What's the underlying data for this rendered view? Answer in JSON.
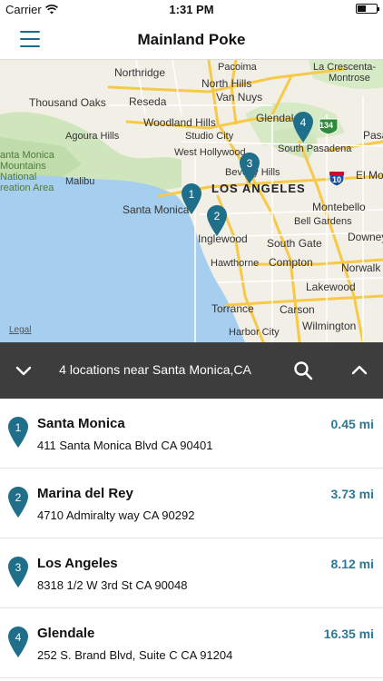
{
  "status_bar": {
    "carrier": "Carrier",
    "time": "1:31 PM"
  },
  "nav": {
    "title": "Mainland Poke"
  },
  "map": {
    "labels": {
      "pacoima": "Pacoima",
      "la_crescenta": "La Crescenta-",
      "montrose": "Montrose",
      "northridge": "Northridge",
      "north_hills": "North Hills",
      "van_nuys": "Van Nuys",
      "thousand_oaks": "Thousand Oaks",
      "reseda": "Reseda",
      "glendale": "Glendal",
      "woodland_hills": "Woodland Hills",
      "agoura_hills": "Agoura Hills",
      "studio_city": "Studio City",
      "south_pasadena": "South Pasadena",
      "pasa": "Pasa",
      "west_hollywood": "West Hollywood",
      "santa_monica_mountains": "anta Monica Mountains National reation Area",
      "malibu": "Malibu",
      "beverly_hills": "Beverly Hills",
      "el_mo": "El Mo",
      "los_angeles": "LOS ANGELES",
      "santa_monica": "Santa Monica",
      "montebello": "Montebello",
      "bell_gardens": "Bell Gardens",
      "inglewood": "Inglewood",
      "south_gate": "South Gate",
      "downey": "Downey",
      "hawthorne": "Hawthorne",
      "compton": "Compton",
      "norwalk": "Norwalk",
      "torrance": "Torrance",
      "lakewood": "Lakewood",
      "carson": "Carson",
      "wilmington": "Wilmington",
      "harbor_city": "Harbor City",
      "shield_134": "134",
      "shield_10": "10"
    },
    "legal": "Legal",
    "pins": [
      "1",
      "2",
      "3",
      "4"
    ]
  },
  "search_bar": {
    "text": "4 locations near Santa Monica,CA"
  },
  "locations": [
    {
      "num": "1",
      "name": "Santa Monica",
      "address": "411 Santa Monica Blvd CA 90401",
      "distance": "0.45 mi"
    },
    {
      "num": "2",
      "name": "Marina del Rey",
      "address": "4710 Admiralty way CA 90292",
      "distance": "3.73 mi"
    },
    {
      "num": "3",
      "name": "Los Angeles",
      "address": "8318 1/2 W 3rd St CA 90048",
      "distance": "8.12 mi"
    },
    {
      "num": "4",
      "name": "Glendale",
      "address": "252 S. Brand Blvd, Suite C CA 91204",
      "distance": "16.35 mi"
    }
  ],
  "colors": {
    "accent": "#2b7a99",
    "pin": "#1f6f8b",
    "search_bar": "#3d3d3d",
    "water": "#a6cfef",
    "park": "#cfe6bd"
  },
  "icons": {
    "menu": "hamburger-icon",
    "search": "search-icon",
    "collapse": "chevron-down-icon",
    "expand": "chevron-up-icon",
    "pin": "map-pin-icon"
  }
}
